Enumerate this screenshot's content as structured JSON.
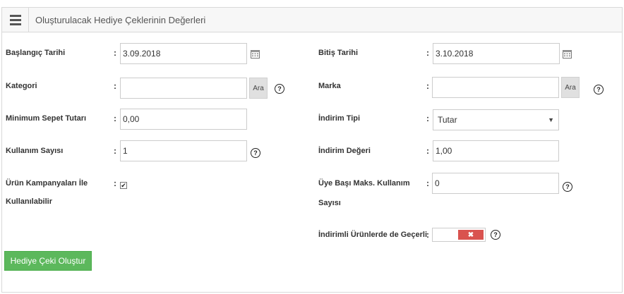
{
  "header": {
    "title": "Oluşturulacak Hediye Çeklerinin Değerleri"
  },
  "form": {
    "start_date": {
      "label": "Başlangıç Tarihi",
      "value": "3.09.2018"
    },
    "end_date": {
      "label": "Bitiş Tarihi",
      "value": "3.10.2018"
    },
    "category": {
      "label": "Kategori",
      "value": "",
      "search_label": "Ara"
    },
    "brand": {
      "label": "Marka",
      "value": "",
      "search_label": "Ara"
    },
    "min_cart": {
      "label": "Minimum Sepet Tutarı",
      "value": "0,00"
    },
    "discount_type": {
      "label": "İndirim Tipi",
      "value": "Tutar"
    },
    "usage_count": {
      "label": "Kullanım Sayısı",
      "value": "1"
    },
    "discount_value": {
      "label": "İndirim Değeri",
      "value": "1,00"
    },
    "product_campaigns": {
      "label_line1": "Ürün Kampanyaları İle",
      "label_line2": "Kullanılabilir",
      "checked": true
    },
    "max_per_member": {
      "label_line1": "Üye Başı Maks. Kullanım",
      "label_line2": "Sayısı",
      "value": "0"
    },
    "discounted_products": {
      "label": "İndirimli Ürünlerde de Geçerli",
      "value": false
    },
    "colon": ":",
    "help_glyph": "?",
    "submit_label": "Hediye Çeki Oluştur"
  },
  "colors": {
    "accent_green": "#5cb85c",
    "toggle_off_red": "#d9534f"
  }
}
